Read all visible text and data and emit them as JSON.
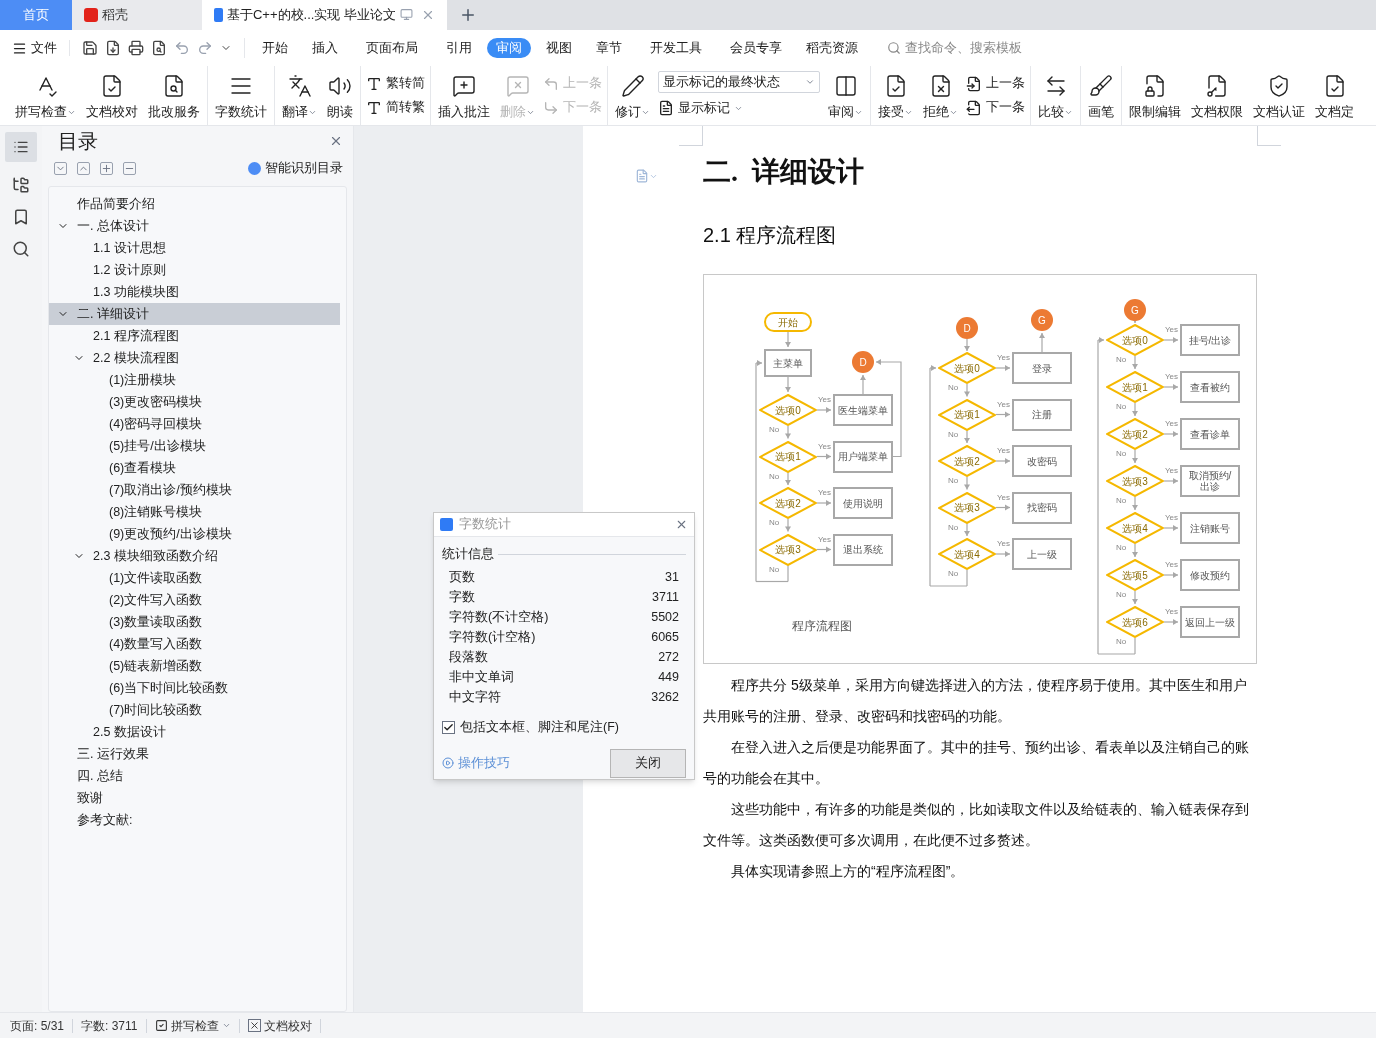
{
  "tabs": [
    {
      "label": "首页",
      "kind": "home",
      "selected": false
    },
    {
      "label": "稻壳",
      "kind": "app",
      "selected": false
    },
    {
      "label": "基于C++的校...实现 毕业论文",
      "kind": "doc",
      "selected": true
    }
  ],
  "menu": {
    "file": "文件",
    "tabs": [
      {
        "label": "开始",
        "selected": false
      },
      {
        "label": "插入",
        "selected": false
      },
      {
        "label": "页面布局",
        "selected": false
      },
      {
        "label": "引用",
        "selected": false
      },
      {
        "label": "审阅",
        "selected": true
      },
      {
        "label": "视图",
        "selected": false
      },
      {
        "label": "章节",
        "selected": false
      },
      {
        "label": "开发工具",
        "selected": false
      },
      {
        "label": "会员专享",
        "selected": false
      },
      {
        "label": "稻壳资源",
        "selected": false
      }
    ],
    "search_placeholder": "查找命令、搜索模板"
  },
  "ribbon": [
    [
      {
        "kind": "large",
        "label": "拼写检查",
        "caret": true,
        "disabled": false
      },
      {
        "kind": "large",
        "label": "文档校对",
        "caret": false,
        "disabled": false
      },
      {
        "kind": "large",
        "label": "批改服务",
        "caret": false,
        "disabled": false
      }
    ],
    [
      {
        "kind": "large",
        "label": "字数统计",
        "caret": false,
        "disabled": false
      }
    ],
    [
      {
        "kind": "large",
        "label": "翻译",
        "caret": true,
        "disabled": false
      },
      {
        "kind": "large",
        "label": "朗读",
        "caret": false,
        "disabled": false
      }
    ],
    [
      {
        "kind": "stack",
        "items": [
          {
            "label": "繁转简",
            "caret": false,
            "disabled": false
          },
          {
            "label": "简转繁",
            "caret": false,
            "disabled": false
          }
        ]
      }
    ],
    [
      {
        "kind": "large",
        "label": "插入批注",
        "caret": false,
        "disabled": false
      },
      {
        "kind": "large",
        "label": "删除",
        "caret": true,
        "disabled": true
      },
      {
        "kind": "stack",
        "items": [
          {
            "label": "上一条",
            "caret": false,
            "disabled": true
          },
          {
            "label": "下一条",
            "caret": false,
            "disabled": true
          }
        ]
      }
    ],
    [
      {
        "kind": "large",
        "label": "修订",
        "caret": true,
        "disabled": false
      },
      {
        "kind": "select",
        "value": "显示标记的最终状态",
        "item": {
          "label": "显示标记",
          "caret": true,
          "disabled": false
        }
      },
      {
        "kind": "large",
        "label": "审阅",
        "caret": true,
        "disabled": false
      }
    ],
    [
      {
        "kind": "large",
        "label": "接受",
        "caret": true,
        "disabled": false
      },
      {
        "kind": "large",
        "label": "拒绝",
        "caret": true,
        "disabled": false
      },
      {
        "kind": "stack",
        "items": [
          {
            "label": "上一条",
            "caret": false,
            "disabled": false
          },
          {
            "label": "下一条",
            "caret": false,
            "disabled": false
          }
        ]
      }
    ],
    [
      {
        "kind": "large",
        "label": "比较",
        "caret": true,
        "disabled": false
      }
    ],
    [
      {
        "kind": "large",
        "label": "画笔",
        "caret": false,
        "disabled": false
      }
    ],
    [
      {
        "kind": "large",
        "label": "限制编辑",
        "caret": false,
        "disabled": false
      },
      {
        "kind": "large",
        "label": "文档权限",
        "caret": false,
        "disabled": false
      },
      {
        "kind": "large",
        "label": "文档认证",
        "caret": false,
        "disabled": false
      },
      {
        "kind": "large",
        "label": "文档定",
        "caret": false,
        "disabled": false
      }
    ]
  ],
  "sidebar": {
    "title": "目录",
    "smart_toc": "智能识别目录",
    "toc": [
      {
        "label": "作品简要介绍",
        "selected": false
      },
      {
        "label": "一. 总体设计",
        "selected": false,
        "expanded": true,
        "children": [
          {
            "label": "1.1 设计思想",
            "selected": false
          },
          {
            "label": "1.2 设计原则",
            "selected": false
          },
          {
            "label": "1.3 功能模块图",
            "selected": false
          }
        ]
      },
      {
        "label": "二. 详细设计",
        "selected": true,
        "expanded": true,
        "children": [
          {
            "label": "2.1 程序流程图",
            "selected": false
          },
          {
            "label": "2.2 模块流程图",
            "selected": false,
            "expanded": true,
            "children": [
              {
                "label": "(1)注册模块",
                "selected": false
              },
              {
                "label": "(3)更改密码模块",
                "selected": false
              },
              {
                "label": "(4)密码寻回模块",
                "selected": false
              },
              {
                "label": "(5)挂号/出诊模块",
                "selected": false
              },
              {
                "label": "(6)查看模块",
                "selected": false
              },
              {
                "label": "(7)取消出诊/预约模块",
                "selected": false
              },
              {
                "label": "(8)注销账号模块",
                "selected": false
              },
              {
                "label": "(9)更改预约/出诊模块",
                "selected": false
              }
            ]
          },
          {
            "label": "2.3 模块细致函数介绍",
            "selected": false,
            "expanded": true,
            "children": [
              {
                "label": "(1)文件读取函数",
                "selected": false
              },
              {
                "label": "(2)文件写入函数",
                "selected": false
              },
              {
                "label": "(3)数量读取函数",
                "selected": false
              },
              {
                "label": "(4)数量写入函数",
                "selected": false
              },
              {
                "label": "(5)链表新增函数",
                "selected": false
              },
              {
                "label": "(6)当下时间比较函数",
                "selected": false
              },
              {
                "label": "(7)时间比较函数",
                "selected": false
              }
            ]
          },
          {
            "label": "2.5 数据设计",
            "selected": false
          }
        ]
      },
      {
        "label": "三. 运行效果",
        "selected": false
      },
      {
        "label": "四. 总结",
        "selected": false
      },
      {
        "label": "致谢",
        "selected": false
      },
      {
        "label": "参考文献:",
        "selected": false
      }
    ]
  },
  "document": {
    "heading": "二.  详细设计",
    "subheading": "2.1 程序流程图",
    "flowchart": {
      "start": "开始",
      "main_menu": "主菜单",
      "caption": "程序流程图",
      "columns": [
        {
          "exit": "D",
          "decisions": [
            {
              "label": "选项0",
              "action": "医生端菜单",
              "yes": "Yes",
              "no": "No"
            },
            {
              "label": "选项1",
              "action": "用户端菜单",
              "yes": "Yes",
              "no": "No"
            },
            {
              "label": "选项2",
              "action": "使用说明",
              "yes": "Yes",
              "no": "No"
            },
            {
              "label": "选项3",
              "action": "退出系统",
              "yes": "Yes",
              "no": "No"
            }
          ]
        },
        {
          "entry": "D",
          "exit": "G",
          "decisions": [
            {
              "label": "选项0",
              "action": "登录",
              "yes": "Yes",
              "no": "No"
            },
            {
              "label": "选项1",
              "action": "注册",
              "yes": "Yes",
              "no": "No"
            },
            {
              "label": "选项2",
              "action": "改密码",
              "yes": "Yes",
              "no": "No"
            },
            {
              "label": "选项3",
              "action": "找密码",
              "yes": "Yes",
              "no": "No"
            },
            {
              "label": "选项4",
              "action": "上一级",
              "yes": "Yes",
              "no": "No"
            }
          ]
        },
        {
          "entry": "G",
          "decisions": [
            {
              "label": "选项0",
              "action": "挂号/出诊",
              "yes": "Yes",
              "no": "No"
            },
            {
              "label": "选项1",
              "action": "查看被约",
              "yes": "Yes",
              "no": "No"
            },
            {
              "label": "选项2",
              "action": "查看诊单",
              "yes": "Yes",
              "no": "No"
            },
            {
              "label": "选项3",
              "action": "取消预约/出诊",
              "yes": "Yes",
              "no": "No"
            },
            {
              "label": "选项4",
              "action": "注销账号",
              "yes": "Yes",
              "no": "No"
            },
            {
              "label": "选项5",
              "action": "修改预约",
              "yes": "Yes",
              "no": "No"
            },
            {
              "label": "选项6",
              "action": "返回上一级",
              "yes": "Yes",
              "no": "No"
            }
          ]
        }
      ]
    },
    "paragraphs": [
      "程序共分 5级菜单，采用方向键选择进入的方法，使程序易于使用。其中医生和用户共用账号的注册、登录、改密码和找密码的功能。",
      "在登入进入之后便是功能界面了。其中的挂号、预约出诊、看表单以及注销自己的账号的功能会在其中。",
      "这些功能中，有许多的功能是类似的，比如读取文件以及给链表的、输入链表保存到文件等。这类函数便可多次调用，在此便不过多赘述。",
      "具体实现请参照上方的“程序流程图”。"
    ]
  },
  "dialog": {
    "title": "字数统计",
    "section": "统计信息",
    "rows": [
      {
        "label": "页数",
        "value": "31"
      },
      {
        "label": "字数",
        "value": "3711"
      },
      {
        "label": "字符数(不计空格)",
        "value": "5502"
      },
      {
        "label": "字符数(计空格)",
        "value": "6065"
      },
      {
        "label": "段落数",
        "value": "272"
      },
      {
        "label": "非中文单词",
        "value": "449"
      },
      {
        "label": "中文字符",
        "value": "3262"
      }
    ],
    "checkbox": {
      "label": "包括文本框、脚注和尾注(F)",
      "checked": true
    },
    "tips": "操作技巧",
    "close": "关闭"
  },
  "status_bar": {
    "page": "页面: 5/31",
    "words": "字数: 3711",
    "spell": "拼写检查",
    "proof": "文档校对"
  }
}
